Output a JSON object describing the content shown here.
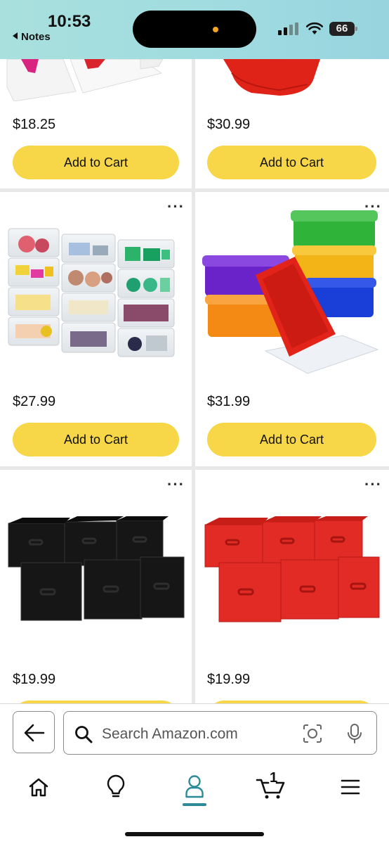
{
  "status_bar": {
    "time": "10:53",
    "back_label": "Notes",
    "battery": "66"
  },
  "products": [
    {
      "price": "$18.25",
      "cart_label": "Add to Cart"
    },
    {
      "price": "$30.99",
      "cart_label": "Add to Cart"
    },
    {
      "price": "$27.99",
      "cart_label": "Add to Cart"
    },
    {
      "price": "$31.99",
      "cart_label": "Add to Cart"
    },
    {
      "price": "$19.99"
    },
    {
      "price": "$19.99"
    }
  ],
  "search": {
    "placeholder": "Search Amazon.com"
  },
  "tabs": [
    {
      "icon": "home-icon"
    },
    {
      "icon": "lightbulb-icon"
    },
    {
      "icon": "account-icon",
      "active": true
    },
    {
      "icon": "cart-icon",
      "badge": "1"
    },
    {
      "icon": "menu-icon"
    }
  ],
  "colors": {
    "button_yellow": "#f7d647",
    "active_tab": "#2d8a99",
    "status_bar": "#a9e0dd"
  }
}
